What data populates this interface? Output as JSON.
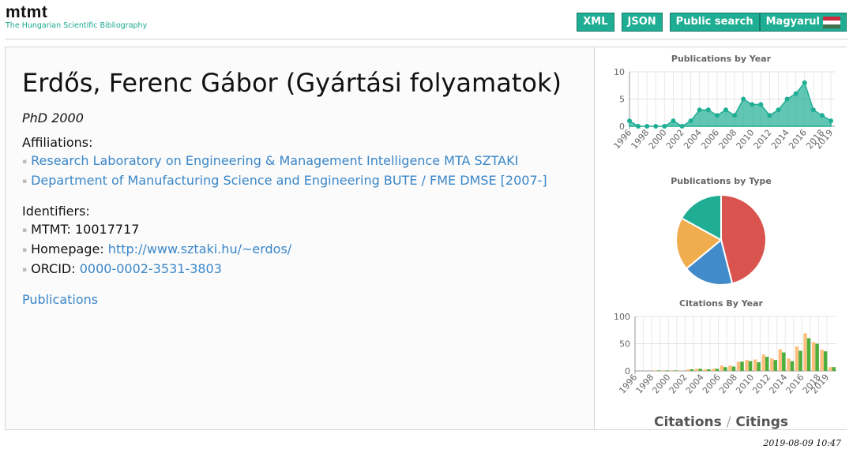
{
  "brand": {
    "title": "mtmt",
    "subtitle": "The Hungarian Scientific Bibliography"
  },
  "topbar": {
    "xml": "XML",
    "json": "JSON",
    "public_search": "Public search",
    "language": "Magyarul",
    "flag_icon": "hungary-flag-icon"
  },
  "profile": {
    "name": "Erdős, Ferenc Gábor (Gyártási folyamatok)",
    "degree": "PhD 2000",
    "affiliations_label": "Affiliations:",
    "affiliations": [
      "Research Laboratory on Engineering & Management Intelligence MTA SZTAKI",
      "Department of Manufacturing Science and Engineering BUTE / FME DMSE [2007-]"
    ],
    "identifiers_label": "Identifiers:",
    "mtmt": "MTMT: 10017717",
    "homepage_label": "Homepage: ",
    "homepage": "http://www.sztaki.hu/~erdos/",
    "orcid_label": "ORCID: ",
    "orcid": "0000-0002-3531-3803",
    "publications_link": "Publications"
  },
  "chart_data": [
    {
      "type": "area",
      "title": "Publications by Year",
      "x": [
        1996,
        1997,
        1998,
        1999,
        2000,
        2001,
        2002,
        2003,
        2004,
        2005,
        2006,
        2007,
        2008,
        2009,
        2010,
        2011,
        2012,
        2013,
        2014,
        2015,
        2016,
        2017,
        2018,
        2019
      ],
      "x_tick_labels": [
        "1996",
        "1998",
        "2000",
        "2002",
        "2004",
        "2006",
        "2008",
        "2010",
        "2012",
        "2014",
        "2016",
        "2018",
        "2019"
      ],
      "values": [
        1,
        0,
        0,
        0,
        0,
        1,
        0,
        1,
        3,
        3,
        2,
        3,
        2,
        5,
        4,
        4,
        2,
        3,
        5,
        6,
        8,
        3,
        2,
        1
      ],
      "ylim": [
        0,
        10
      ],
      "y_ticks": [
        0,
        5,
        10
      ],
      "grid": true,
      "color": "#1fae94"
    },
    {
      "type": "pie",
      "title": "Publications by Type",
      "values": [
        0.46,
        0.18,
        0.19,
        0.17
      ],
      "colors": [
        "#d9534f",
        "#428bca",
        "#f0ad4e",
        "#1fae94"
      ]
    },
    {
      "type": "bar",
      "title": "Citations By Year",
      "x": [
        1996,
        1997,
        1998,
        1999,
        2000,
        2001,
        2002,
        2003,
        2004,
        2005,
        2006,
        2007,
        2008,
        2009,
        2010,
        2011,
        2012,
        2013,
        2014,
        2015,
        2016,
        2017,
        2018,
        2019
      ],
      "x_tick_labels": [
        "1996",
        "1998",
        "2000",
        "2002",
        "2004",
        "2006",
        "2008",
        "2010",
        "2012",
        "2014",
        "2016",
        "2018",
        "2019"
      ],
      "series": [
        {
          "values": [
            0,
            0,
            1,
            1,
            1,
            1,
            3,
            4,
            3,
            4,
            10,
            10,
            17,
            20,
            21,
            30,
            23,
            40,
            23,
            45,
            69,
            53,
            39,
            7
          ],
          "color": "#fdbf80"
        },
        {
          "values": [
            0,
            0,
            1,
            1,
            1,
            0,
            3,
            4,
            3,
            4,
            7,
            8,
            17,
            18,
            16,
            26,
            20,
            34,
            18,
            37,
            60,
            50,
            36,
            7
          ],
          "color": "#4cae3c"
        }
      ],
      "ylim": [
        0,
        100
      ],
      "y_ticks": [
        0,
        50,
        100
      ],
      "grid": true
    }
  ],
  "sidebar": {
    "citations": "Citations",
    "sep": "/",
    "citings": "Citings"
  },
  "timestamp": "2019-08-09 10:47"
}
